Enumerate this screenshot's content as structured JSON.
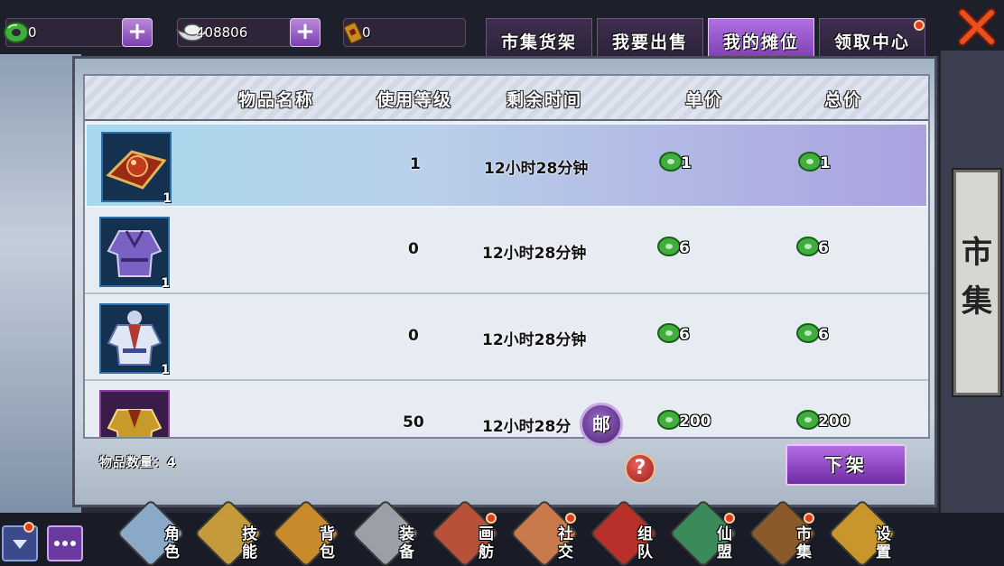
{
  "currency": {
    "jade": "0",
    "silver": "408806",
    "ticket": "0"
  },
  "tabs": [
    {
      "label": "市集货架",
      "active": false
    },
    {
      "label": "我要出售",
      "active": false
    },
    {
      "label": "我的摊位",
      "active": true
    },
    {
      "label": "领取中心",
      "active": false
    }
  ],
  "side_title": "市集",
  "columns": {
    "name": "物品名称",
    "level": "使用等级",
    "time": "剩余时间",
    "unit_price": "单价",
    "total_price": "总价"
  },
  "items": [
    {
      "icon": "carpet-orb-icon",
      "qty": "1",
      "level": "1",
      "time": "12小时28分钟",
      "unit_price": "1",
      "total_price": "1",
      "selected": true,
      "frame": "blue"
    },
    {
      "icon": "purple-robe-icon",
      "qty": "1",
      "level": "0",
      "time": "12小时28分钟",
      "unit_price": "6",
      "total_price": "6",
      "selected": false,
      "frame": "blue"
    },
    {
      "icon": "blue-armor-icon",
      "qty": "1",
      "level": "0",
      "time": "12小时28分钟",
      "unit_price": "6",
      "total_price": "6",
      "selected": false,
      "frame": "blue"
    },
    {
      "icon": "gold-armor-icon",
      "qty": "",
      "level": "50",
      "time": "12小时28分",
      "unit_price": "200",
      "total_price": "200",
      "selected": false,
      "frame": "purple"
    }
  ],
  "item_count_label": "物品数量：4",
  "help_label": "?",
  "unlist_label": "下架",
  "mail_label": "邮",
  "bottom_menu": [
    {
      "label": "角色",
      "icon": "character-icon",
      "badge": false
    },
    {
      "label": "技能",
      "icon": "skill-icon",
      "badge": false
    },
    {
      "label": "背包",
      "icon": "bag-icon",
      "badge": false
    },
    {
      "label": "装备",
      "icon": "equipment-icon",
      "badge": false
    },
    {
      "label": "画舫",
      "icon": "painted-boat-icon",
      "badge": true
    },
    {
      "label": "社交",
      "icon": "social-icon",
      "badge": true
    },
    {
      "label": "组队",
      "icon": "team-icon",
      "badge": false
    },
    {
      "label": "仙盟",
      "icon": "guild-icon",
      "badge": true
    },
    {
      "label": "市集",
      "icon": "market-icon",
      "badge": true
    },
    {
      "label": "设置",
      "icon": "settings-icon",
      "badge": false
    }
  ],
  "colors": {
    "accent_purple": "#8a45c0",
    "badge_red": "#e23a1c",
    "jade_green": "#3fae3a"
  }
}
